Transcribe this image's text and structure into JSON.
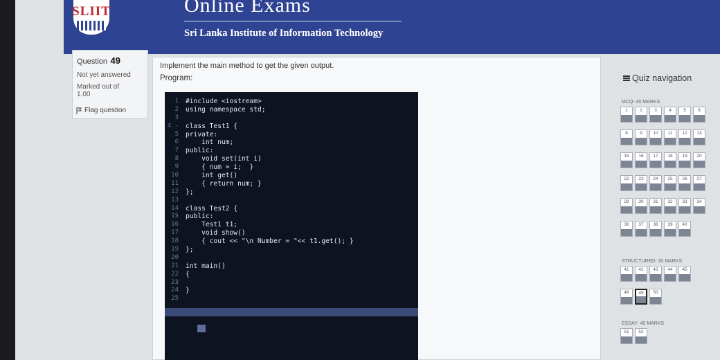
{
  "header": {
    "logo": "SLIIT",
    "title": "Online Exams",
    "subtitle": "Sri Lanka Institute of Information Technology"
  },
  "question_info": {
    "label": "Question",
    "number": "49",
    "status": "Not yet answered",
    "marks": "Marked out of",
    "marks_value": "1.00",
    "flag_label": "Flag question"
  },
  "question": {
    "prompt": "Implement the main method to get the given output.",
    "program_label": "Program:"
  },
  "editor": {
    "lines": [
      {
        "n": "1",
        "code": "#include <iostream>"
      },
      {
        "n": "2",
        "code": "using namespace std;"
      },
      {
        "n": "3",
        "code": ""
      },
      {
        "n": "4 -",
        "code": "class Test1 {"
      },
      {
        "n": "5",
        "code": "private:"
      },
      {
        "n": "6",
        "code": "    int num;"
      },
      {
        "n": "7",
        "code": "public:"
      },
      {
        "n": "8",
        "code": "    void set(int i)"
      },
      {
        "n": "9",
        "code": "    { num = i;  }"
      },
      {
        "n": "10",
        "code": "    int get()"
      },
      {
        "n": "11",
        "code": "    { return num; }"
      },
      {
        "n": "12",
        "code": "};"
      },
      {
        "n": "13",
        "code": ""
      },
      {
        "n": "14 -",
        "code": "class Test2 {"
      },
      {
        "n": "15",
        "code": "public:"
      },
      {
        "n": "16",
        "code": "    Test1 t1;"
      },
      {
        "n": "17",
        "code": "    void show()"
      },
      {
        "n": "18",
        "code": "    { cout << \"\\n Number = \"<< t1.get(); }"
      },
      {
        "n": "19",
        "code": "};"
      },
      {
        "n": "20",
        "code": ""
      },
      {
        "n": "21",
        "code": "int main()"
      },
      {
        "n": "22 -",
        "code": "{"
      },
      {
        "n": "23",
        "code": ""
      },
      {
        "n": "24",
        "code": "}"
      },
      {
        "n": "25",
        "code": ""
      }
    ]
  },
  "quiz_nav": {
    "title": "Quiz navigation",
    "sections": [
      {
        "label": "MCQ- 40 MARKS",
        "rows": [
          [
            "1",
            "2",
            "3",
            "4",
            "5",
            "6"
          ],
          [
            "8",
            "9",
            "10",
            "11",
            "12",
            "13"
          ],
          [
            "15",
            "16",
            "17",
            "18",
            "19",
            "20"
          ],
          [
            "22",
            "23",
            "24",
            "25",
            "26",
            "27"
          ],
          [
            "29",
            "30",
            "31",
            "32",
            "33",
            "34"
          ],
          [
            "36",
            "37",
            "38",
            "39",
            "40"
          ]
        ]
      },
      {
        "label": "STRUCTURED- 30 MARKS",
        "rows": [
          [
            "41",
            "42",
            "43",
            "44",
            "45"
          ],
          [
            "48",
            "49",
            "50"
          ]
        ]
      },
      {
        "label": "ESSAY- 40 MARKS",
        "rows": [
          [
            "51",
            "52"
          ]
        ]
      }
    ],
    "current": "49"
  }
}
